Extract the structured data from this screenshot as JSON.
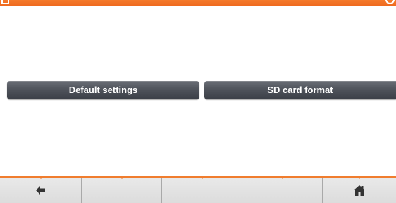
{
  "buttons": {
    "default_settings": "Default settings",
    "sd_card_format": "SD card format"
  },
  "softkeys": [
    {
      "icon": "back-arrow-icon"
    },
    {
      "icon": ""
    },
    {
      "icon": ""
    },
    {
      "icon": ""
    },
    {
      "icon": "home-icon"
    }
  ],
  "colors": {
    "accent": "#f07d2e",
    "button": "#4f535b",
    "softkey_bar": "#e2e2e2"
  }
}
